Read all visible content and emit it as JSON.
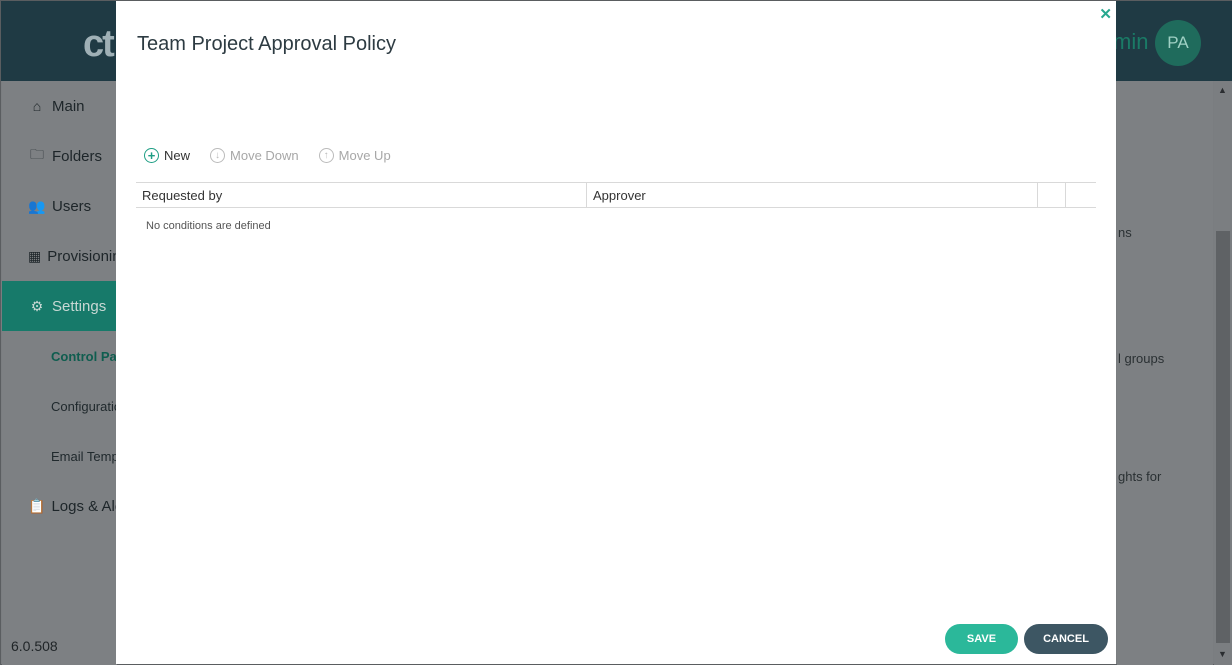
{
  "app": {
    "logo_text": "ct",
    "user_name_partial": "min",
    "avatar_initials": "PA",
    "version": "6.0.508"
  },
  "sidebar": {
    "items": [
      {
        "label": "Main",
        "icon": "home-icon"
      },
      {
        "label": "Folders",
        "icon": "folders-icon"
      },
      {
        "label": "Users",
        "icon": "users-icon"
      },
      {
        "label": "Provisioning",
        "icon": "provisioning-icon"
      },
      {
        "label": "Settings",
        "icon": "gear-icon"
      },
      {
        "label": "Logs & Alerts",
        "icon": "clipboard-icon"
      }
    ],
    "subitems": [
      {
        "label": "Control Panel"
      },
      {
        "label": "Configuration"
      },
      {
        "label": "Email Templates"
      }
    ]
  },
  "background_text": {
    "line1": "ns",
    "line2": "l groups",
    "line3": "ghts for"
  },
  "modal": {
    "title": "Team Project Approval Policy",
    "close_icon": "close-icon",
    "toolbar": {
      "new_label": "New",
      "move_down_label": "Move Down",
      "move_up_label": "Move Up"
    },
    "grid": {
      "columns": [
        "Requested by",
        "Approver",
        "",
        ""
      ],
      "empty_message": "No conditions are defined"
    },
    "save_label": "SAVE",
    "cancel_label": "CANCEL"
  },
  "colors": {
    "accent": "#2bb89a",
    "header": "#1f3a44",
    "cancel": "#3d5663"
  }
}
